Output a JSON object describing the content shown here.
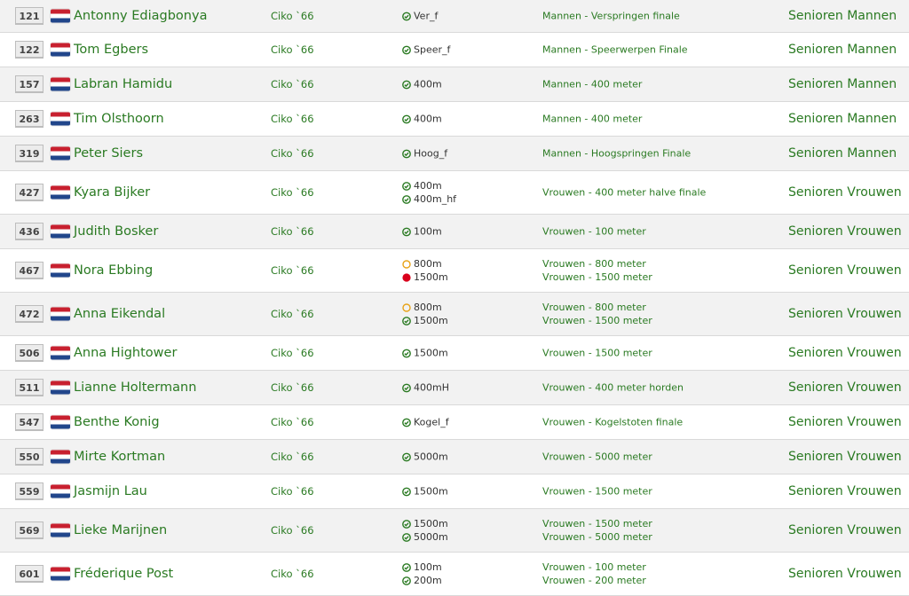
{
  "colors": {
    "text_green": "#2a7a22",
    "status_confirmed": "#2a7a22",
    "status_pending": "#e8a317",
    "status_withdrawn": "#d9001b",
    "row_alt": "#f2f2f2"
  },
  "icons": {
    "confirmed": "check-circle-icon",
    "pending": "empty-circle-icon",
    "withdrawn": "red-dot-icon",
    "flag": "netherlands-flag-icon"
  },
  "entries": [
    {
      "bib": "121",
      "name": "Antonny Ediagbonya",
      "club": "Ciko `66",
      "events": [
        {
          "code": "Ver_f",
          "status": "confirmed",
          "desc": "Mannen - Verspringen finale"
        }
      ],
      "category": "Senioren Mannen"
    },
    {
      "bib": "122",
      "name": "Tom Egbers",
      "club": "Ciko `66",
      "events": [
        {
          "code": "Speer_f",
          "status": "confirmed",
          "desc": "Mannen - Speerwerpen Finale"
        }
      ],
      "category": "Senioren Mannen"
    },
    {
      "bib": "157",
      "name": "Labran Hamidu",
      "club": "Ciko `66",
      "events": [
        {
          "code": "400m",
          "status": "confirmed",
          "desc": "Mannen - 400 meter"
        }
      ],
      "category": "Senioren Mannen"
    },
    {
      "bib": "263",
      "name": "Tim Olsthoorn",
      "club": "Ciko `66",
      "events": [
        {
          "code": "400m",
          "status": "confirmed",
          "desc": "Mannen - 400 meter"
        }
      ],
      "category": "Senioren Mannen"
    },
    {
      "bib": "319",
      "name": "Peter Siers",
      "club": "Ciko `66",
      "events": [
        {
          "code": "Hoog_f",
          "status": "confirmed",
          "desc": "Mannen - Hoogspringen Finale"
        }
      ],
      "category": "Senioren Mannen"
    },
    {
      "bib": "427",
      "name": "Kyara Bijker",
      "club": "Ciko `66",
      "events": [
        {
          "code": "400m",
          "status": "confirmed",
          "desc": "Vrouwen - 400 meter halve finale"
        },
        {
          "code": "400m_hf",
          "status": "confirmed",
          "desc": ""
        }
      ],
      "category": "Senioren Vrouwen"
    },
    {
      "bib": "436",
      "name": "Judith Bosker",
      "club": "Ciko `66",
      "events": [
        {
          "code": "100m",
          "status": "confirmed",
          "desc": "Vrouwen - 100 meter"
        }
      ],
      "category": "Senioren Vrouwen"
    },
    {
      "bib": "467",
      "name": "Nora Ebbing",
      "club": "Ciko `66",
      "events": [
        {
          "code": "800m",
          "status": "pending",
          "desc": "Vrouwen - 800 meter"
        },
        {
          "code": "1500m",
          "status": "withdrawn",
          "desc": "Vrouwen - 1500 meter"
        }
      ],
      "category": "Senioren Vrouwen"
    },
    {
      "bib": "472",
      "name": "Anna Eikendal",
      "club": "Ciko `66",
      "events": [
        {
          "code": "800m",
          "status": "pending",
          "desc": "Vrouwen - 800 meter"
        },
        {
          "code": "1500m",
          "status": "confirmed",
          "desc": "Vrouwen - 1500 meter"
        }
      ],
      "category": "Senioren Vrouwen"
    },
    {
      "bib": "506",
      "name": "Anna Hightower",
      "club": "Ciko `66",
      "events": [
        {
          "code": "1500m",
          "status": "confirmed",
          "desc": "Vrouwen - 1500 meter"
        }
      ],
      "category": "Senioren Vrouwen"
    },
    {
      "bib": "511",
      "name": "Lianne Holtermann",
      "club": "Ciko `66",
      "events": [
        {
          "code": "400mH",
          "status": "confirmed",
          "desc": "Vrouwen - 400 meter horden"
        }
      ],
      "category": "Senioren Vrouwen"
    },
    {
      "bib": "547",
      "name": "Benthe Konig",
      "club": "Ciko `66",
      "events": [
        {
          "code": "Kogel_f",
          "status": "confirmed",
          "desc": "Vrouwen - Kogelstoten finale"
        }
      ],
      "category": "Senioren Vrouwen"
    },
    {
      "bib": "550",
      "name": "Mirte Kortman",
      "club": "Ciko `66",
      "events": [
        {
          "code": "5000m",
          "status": "confirmed",
          "desc": "Vrouwen - 5000 meter"
        }
      ],
      "category": "Senioren Vrouwen"
    },
    {
      "bib": "559",
      "name": "Jasmijn Lau",
      "club": "Ciko `66",
      "events": [
        {
          "code": "1500m",
          "status": "confirmed",
          "desc": "Vrouwen - 1500 meter"
        }
      ],
      "category": "Senioren Vrouwen"
    },
    {
      "bib": "569",
      "name": "Lieke Marijnen",
      "club": "Ciko `66",
      "events": [
        {
          "code": "1500m",
          "status": "confirmed",
          "desc": "Vrouwen - 1500 meter"
        },
        {
          "code": "5000m",
          "status": "confirmed",
          "desc": "Vrouwen - 5000 meter"
        }
      ],
      "category": "Senioren Vrouwen"
    },
    {
      "bib": "601",
      "name": "Fréderique Post",
      "club": "Ciko `66",
      "events": [
        {
          "code": "100m",
          "status": "confirmed",
          "desc": "Vrouwen - 100 meter"
        },
        {
          "code": "200m",
          "status": "confirmed",
          "desc": "Vrouwen - 200 meter"
        }
      ],
      "category": "Senioren Vrouwen"
    }
  ]
}
